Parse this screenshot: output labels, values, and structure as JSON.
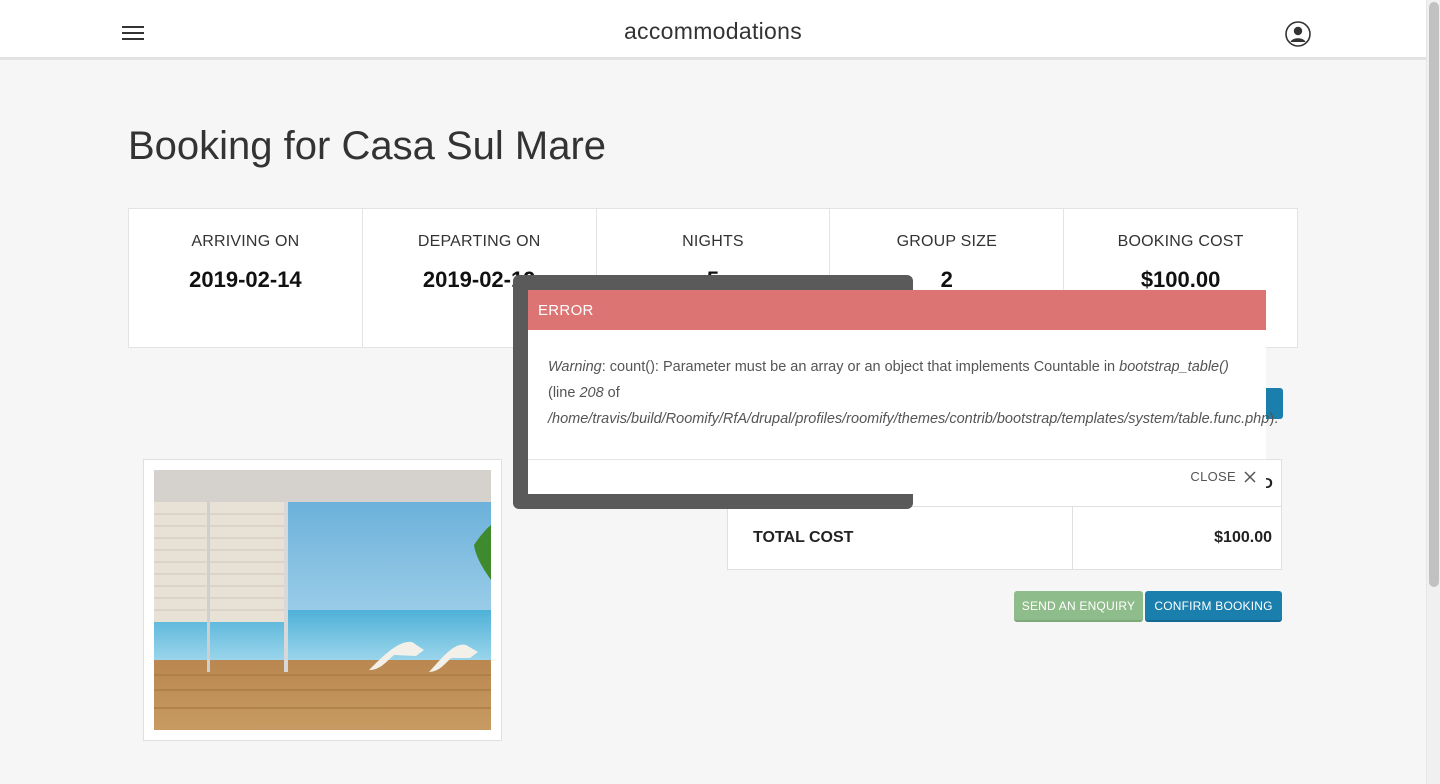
{
  "header": {
    "title": "accommodations",
    "menu_icon": "hamburger-menu-icon",
    "user_icon": "user-account-icon"
  },
  "page": {
    "title": "Booking for Casa Sul Mare"
  },
  "summary": [
    {
      "label": "ARRIVING ON",
      "value": "2019-02-14"
    },
    {
      "label": "DEPARTING ON",
      "value": "2019-02-19"
    },
    {
      "label": "NIGHTS",
      "value": "5"
    },
    {
      "label": "GROUP SIZE",
      "value": "2"
    },
    {
      "label": "BOOKING COST",
      "value": "$100.00"
    }
  ],
  "cost_table": {
    "header_partial": "D",
    "total_label": "TOTAL COST",
    "total_value": "$100.00"
  },
  "buttons": {
    "enquiry": "SEND AN ENQUIRY",
    "confirm": "CONFIRM BOOKING"
  },
  "modal": {
    "title": "ERROR",
    "warning_label": "Warning",
    "message_part1": ": count(): Parameter must be an array or an object that implements Countable in ",
    "function_name": "bootstrap_table()",
    "message_part2": " (line ",
    "line_number": "208",
    "message_part3": " of ",
    "file_path": "/home/travis/build/Roomify/RfA/drupal/profiles/roomify/themes/contrib/bootstrap/templates/system/table.func.php",
    "message_part4": ").",
    "close_label": "CLOSE"
  },
  "colors": {
    "modal_header": "#dc7473",
    "primary_button": "#1a7fad",
    "enquiry_button": "#8fbc8b"
  }
}
